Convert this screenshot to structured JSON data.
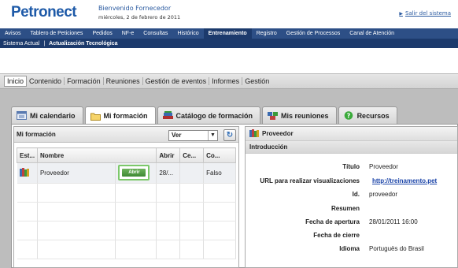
{
  "header": {
    "logo": "Petronect",
    "welcome": "Bienvenido Fornecedor",
    "date": "miércoles, 2 de febrero de 2011",
    "logout": "Salir del sistema"
  },
  "nav_main": [
    "Avisos",
    "Tablero de Peticiones",
    "Pedidos",
    "NF-e",
    "Consultas",
    "Histórico",
    "Entrenamiento",
    "Registro",
    "Gestión de Processos",
    "Canal de Atención"
  ],
  "nav_main_active": "Entrenamiento",
  "nav_sub": {
    "item1": "Sistema Actual",
    "item2": "Actualización Tecnológica"
  },
  "tabbar": [
    "Inicio",
    "Contenido",
    "Formación",
    "Reuniones",
    "Gestión de eventos",
    "Informes",
    "Gestión"
  ],
  "panel_tabs": [
    "Mi calendario",
    "Mi formación",
    "Catálogo de formación",
    "Mis reuniones",
    "Recursos"
  ],
  "left": {
    "title": "Mi formación",
    "select_value": "Ver",
    "columns": [
      "Est...",
      "Nombre",
      "",
      "Abrir",
      "Ce...",
      "Co..."
    ],
    "row": {
      "nombre": "Proveedor",
      "button": "Abrir",
      "abrir": "28/...",
      "co": "Falso"
    }
  },
  "right": {
    "title": "Proveedor",
    "subtitle": "Introducción",
    "fields": [
      {
        "label": "Título",
        "value": "Proveedor"
      },
      {
        "label": "URL para realizar visualizaciones",
        "value": "http://treinamento.pet"
      },
      {
        "label": "Id.",
        "value": "proveedor"
      },
      {
        "label": "Resumen",
        "value": ""
      },
      {
        "label": "Fecha de apertura",
        "value": "28/01/2011 16:00"
      },
      {
        "label": "Fecha de cierre",
        "value": ""
      },
      {
        "label": "Idioma",
        "value": "Portuguës do Brasil"
      }
    ]
  }
}
